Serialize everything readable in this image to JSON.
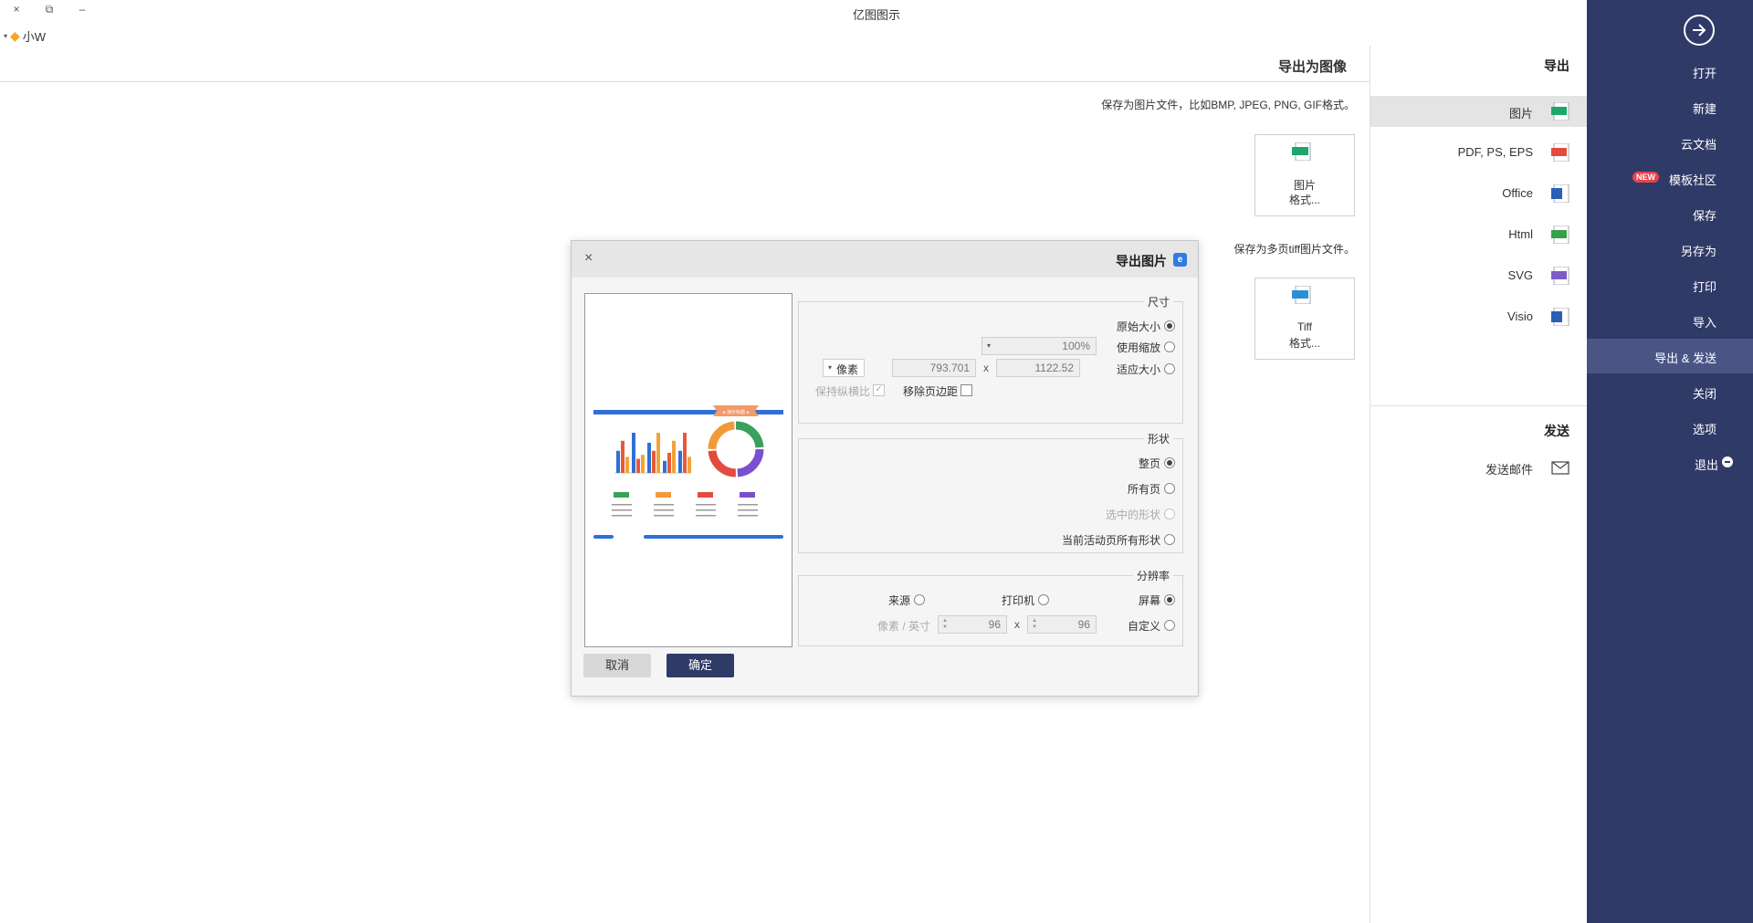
{
  "app": {
    "title": "亿图图示",
    "minimize": "–",
    "restore": "⧉",
    "close": "×"
  },
  "user": {
    "name": "小W",
    "caret": "▾"
  },
  "main": {
    "heading": "导出为图像",
    "desc": "保存为图片文件，比如BMP, JPEG, PNG, GIF格式。",
    "desc2": "保存为多页tiff图片文件。",
    "cards": [
      {
        "line1": "图片",
        "line2": "格式...",
        "icon": "jpg-icon",
        "tag": "JPG"
      },
      {
        "line1": "Tiff",
        "line2": "格式...",
        "icon": "tiff-icon",
        "tag": "TIFF"
      }
    ]
  },
  "middle": {
    "export_title": "导出",
    "send_title": "发送",
    "items": [
      {
        "label": "图片",
        "tag": "JPG",
        "color": "#1ca76b"
      },
      {
        "label": "PDF, PS, EPS",
        "tag": "PDF",
        "color": "#e34b3f"
      },
      {
        "label": "Office",
        "tag": "W",
        "color": "#2b5fb6"
      },
      {
        "label": "Html",
        "tag": "HTML",
        "color": "#3a9e4a"
      },
      {
        "label": "SVG",
        "tag": "SVG",
        "color": "#7b5cc9"
      },
      {
        "label": "Visio",
        "tag": "V",
        "color": "#2b5fb6"
      }
    ],
    "send_items": [
      {
        "label": "发送邮件"
      }
    ]
  },
  "sidebar": {
    "items": [
      {
        "label": "打开"
      },
      {
        "label": "新建"
      },
      {
        "label": "云文档"
      },
      {
        "label": "模板社区",
        "badge": "NEW"
      },
      {
        "label": "保存"
      },
      {
        "label": "另存为"
      },
      {
        "label": "打印"
      },
      {
        "label": "导入"
      },
      {
        "label": "导出 & 发送"
      },
      {
        "label": "关闭"
      },
      {
        "label": "选项"
      },
      {
        "label": "退出"
      }
    ],
    "active": "导出 & 发送"
  },
  "dialog": {
    "title": "导出图片",
    "close": "×",
    "size": {
      "title": "尺寸",
      "original": "原始大小",
      "zoom": "使用缩放",
      "zoom_value": "100%",
      "fit": "适应大小",
      "width": "1122.52",
      "height": "793.701",
      "x": "x",
      "unit": "像素",
      "remove_margin": "移除页边距",
      "keep_ratio": "保持纵横比"
    },
    "shape": {
      "title": "形状",
      "whole_page": "整页",
      "all_pages": "所有页",
      "selected": "选中的形状",
      "current_page_all": "当前活动页所有形状"
    },
    "resolution": {
      "title": "分辨率",
      "screen": "屏幕",
      "printer": "打印机",
      "source": "来源",
      "custom": "自定义",
      "dpi_x": "96",
      "dpi_y": "96",
      "x": "x",
      "unit": "像素 / 英寸"
    },
    "ok": "确定",
    "cancel": "取消"
  },
  "preview": {
    "banner": "● 演示标题 ●",
    "bar_values": [
      0.55,
      0.8,
      0.4,
      1.0,
      0.35,
      0.45,
      0.75,
      0.55,
      1.0,
      0.3,
      0.5,
      0.8,
      0.55,
      1.0,
      0.4
    ],
    "bar_colors": [
      "#2f6fd6",
      "#e45b3b",
      "#f2a23a"
    ],
    "donut_colors": [
      "#3aa05a",
      "#7b4fcf",
      "#e34b3f",
      "#f29a3a"
    ],
    "legend_colors": [
      "#3aa05a",
      "#f29a3a",
      "#e34b3f",
      "#7b4fcf"
    ]
  },
  "colors": {
    "sidebar": "#303a67",
    "sidebar_active": "#4a5586",
    "accent": "#2f7ce0"
  }
}
